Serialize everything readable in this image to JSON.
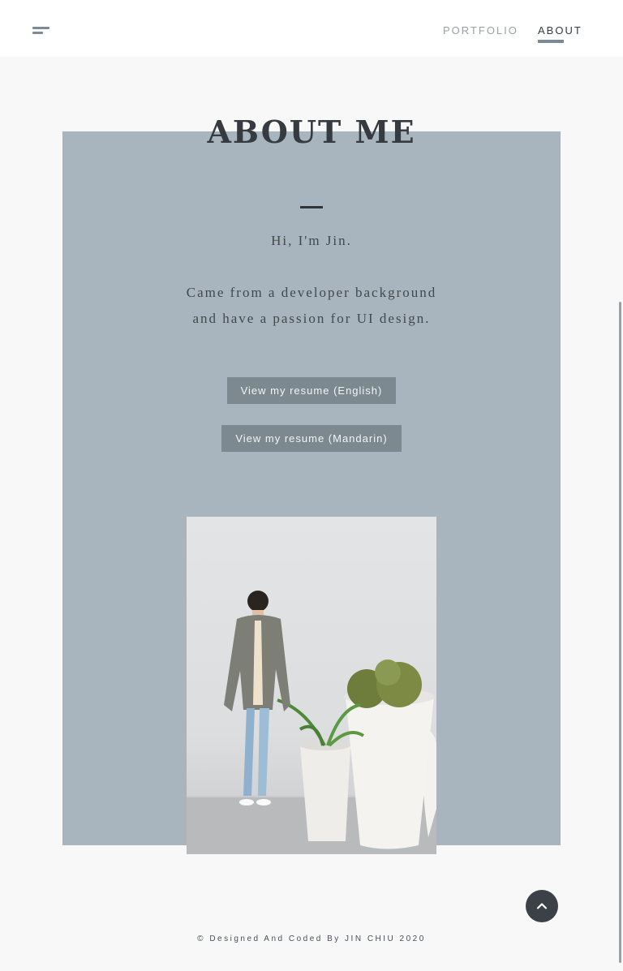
{
  "header": {
    "nav": [
      {
        "label": "PORTFOLIO",
        "active": false
      },
      {
        "label": "ABOUT",
        "active": true
      }
    ],
    "accent_color": "#7b8a97"
  },
  "about": {
    "title": "ABOUT ME",
    "greeting": "Hi, I'm Jin.",
    "bio_lines": [
      "Came from a developer background",
      "and have a passion for UI design."
    ],
    "buttons": {
      "resume_english": "View my resume (English)",
      "resume_mandarin": "View my resume (Mandarin)"
    },
    "card_color": "#a8b5be"
  },
  "footer": {
    "text": "© Designed And Coded By JIN CHIU 2020"
  },
  "icons": {
    "menu": "menu-icon",
    "back_to_top": "chevron-up-icon"
  }
}
